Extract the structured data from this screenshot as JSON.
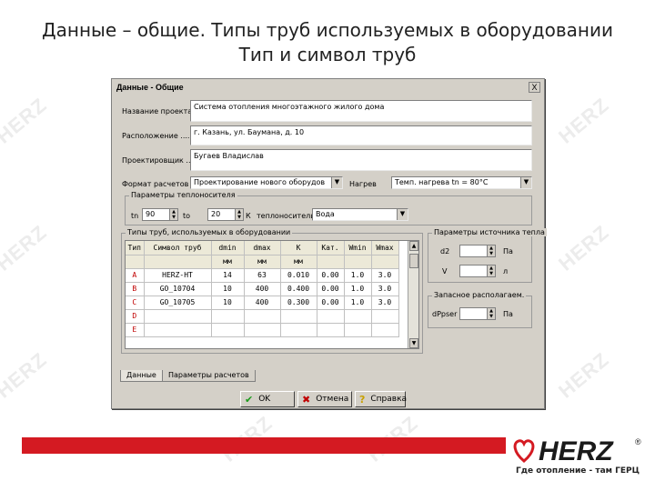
{
  "slide": {
    "title_line1": "Данные – общие. Типы труб используемых в оборудовании",
    "title_line2": "Тип и символ труб",
    "watermark": "HERZ",
    "slogan": "Где отопление - там ГЕРЦ",
    "accent_color": "#d41a22"
  },
  "dialog": {
    "title": "Данные - Общие",
    "close_label": "X",
    "project_name_label": "Название проекта",
    "project_name_value": "Система отопления многоэтажного жилого дома",
    "location_label": "Расположение ....",
    "location_value": "г. Казань, ул. Баумана, д. 10",
    "designer_label": "Проектировщик ...",
    "designer_value": "Бугаев Владислав",
    "calc_format_label": "Формат расчетов",
    "calc_format_value": "Проектирование нового оборудов",
    "heater_label": "Нагрев",
    "heater_value": "Темп. нагрева tn = 80°C",
    "heating_params": {
      "title": "Параметры теплоносителя",
      "tn_label": "tn",
      "tn_value": "90",
      "to_label": "to",
      "to_value": "20",
      "unit_label": "К",
      "fluid_label": "теплоноситель",
      "fluid_value": "Вода"
    },
    "pipe_types": {
      "title": "Типы труб, используемых в оборудовании",
      "columns": [
        "Тип",
        "Символ труб",
        "dmin",
        "dmax",
        "K",
        "Кат.",
        "Wmin",
        "Wmax"
      ],
      "units": [
        "",
        "",
        "мм",
        "мм",
        "мм",
        "",
        "",
        ""
      ],
      "rows": [
        {
          "type": "A",
          "symbol": "HERZ-HT",
          "dmin": "14",
          "dmax": "63",
          "k": "0.010",
          "kat": "0.00",
          "wmin": "1.0",
          "wmax": "3.0"
        },
        {
          "type": "B",
          "symbol": "GO_10704",
          "dmin": "10",
          "dmax": "400",
          "k": "0.400",
          "kat": "0.00",
          "wmin": "1.0",
          "wmax": "3.0"
        },
        {
          "type": "C",
          "symbol": "GO_10705",
          "dmin": "10",
          "dmax": "400",
          "k": "0.300",
          "kat": "0.00",
          "wmin": "1.0",
          "wmax": "3.0"
        },
        {
          "type": "D",
          "symbol": "",
          "dmin": "",
          "dmax": "",
          "k": "",
          "kat": "",
          "wmin": "",
          "wmax": ""
        },
        {
          "type": "E",
          "symbol": "",
          "dmin": "",
          "dmax": "",
          "k": "",
          "kat": "",
          "wmin": "",
          "wmax": ""
        }
      ]
    },
    "source_params": {
      "title": "Параметры источника тепла",
      "d2_label": "d2",
      "d2_unit": "Па",
      "v_label": "V",
      "v_unit": "л"
    },
    "reserve": {
      "title": "Запасное располагаем.",
      "label": "dPpser",
      "unit": "Па"
    },
    "tabs": [
      "Данные",
      "Параметры расчетов"
    ],
    "buttons": {
      "ok": "OK",
      "cancel": "Отмена",
      "help": "Справка"
    }
  }
}
